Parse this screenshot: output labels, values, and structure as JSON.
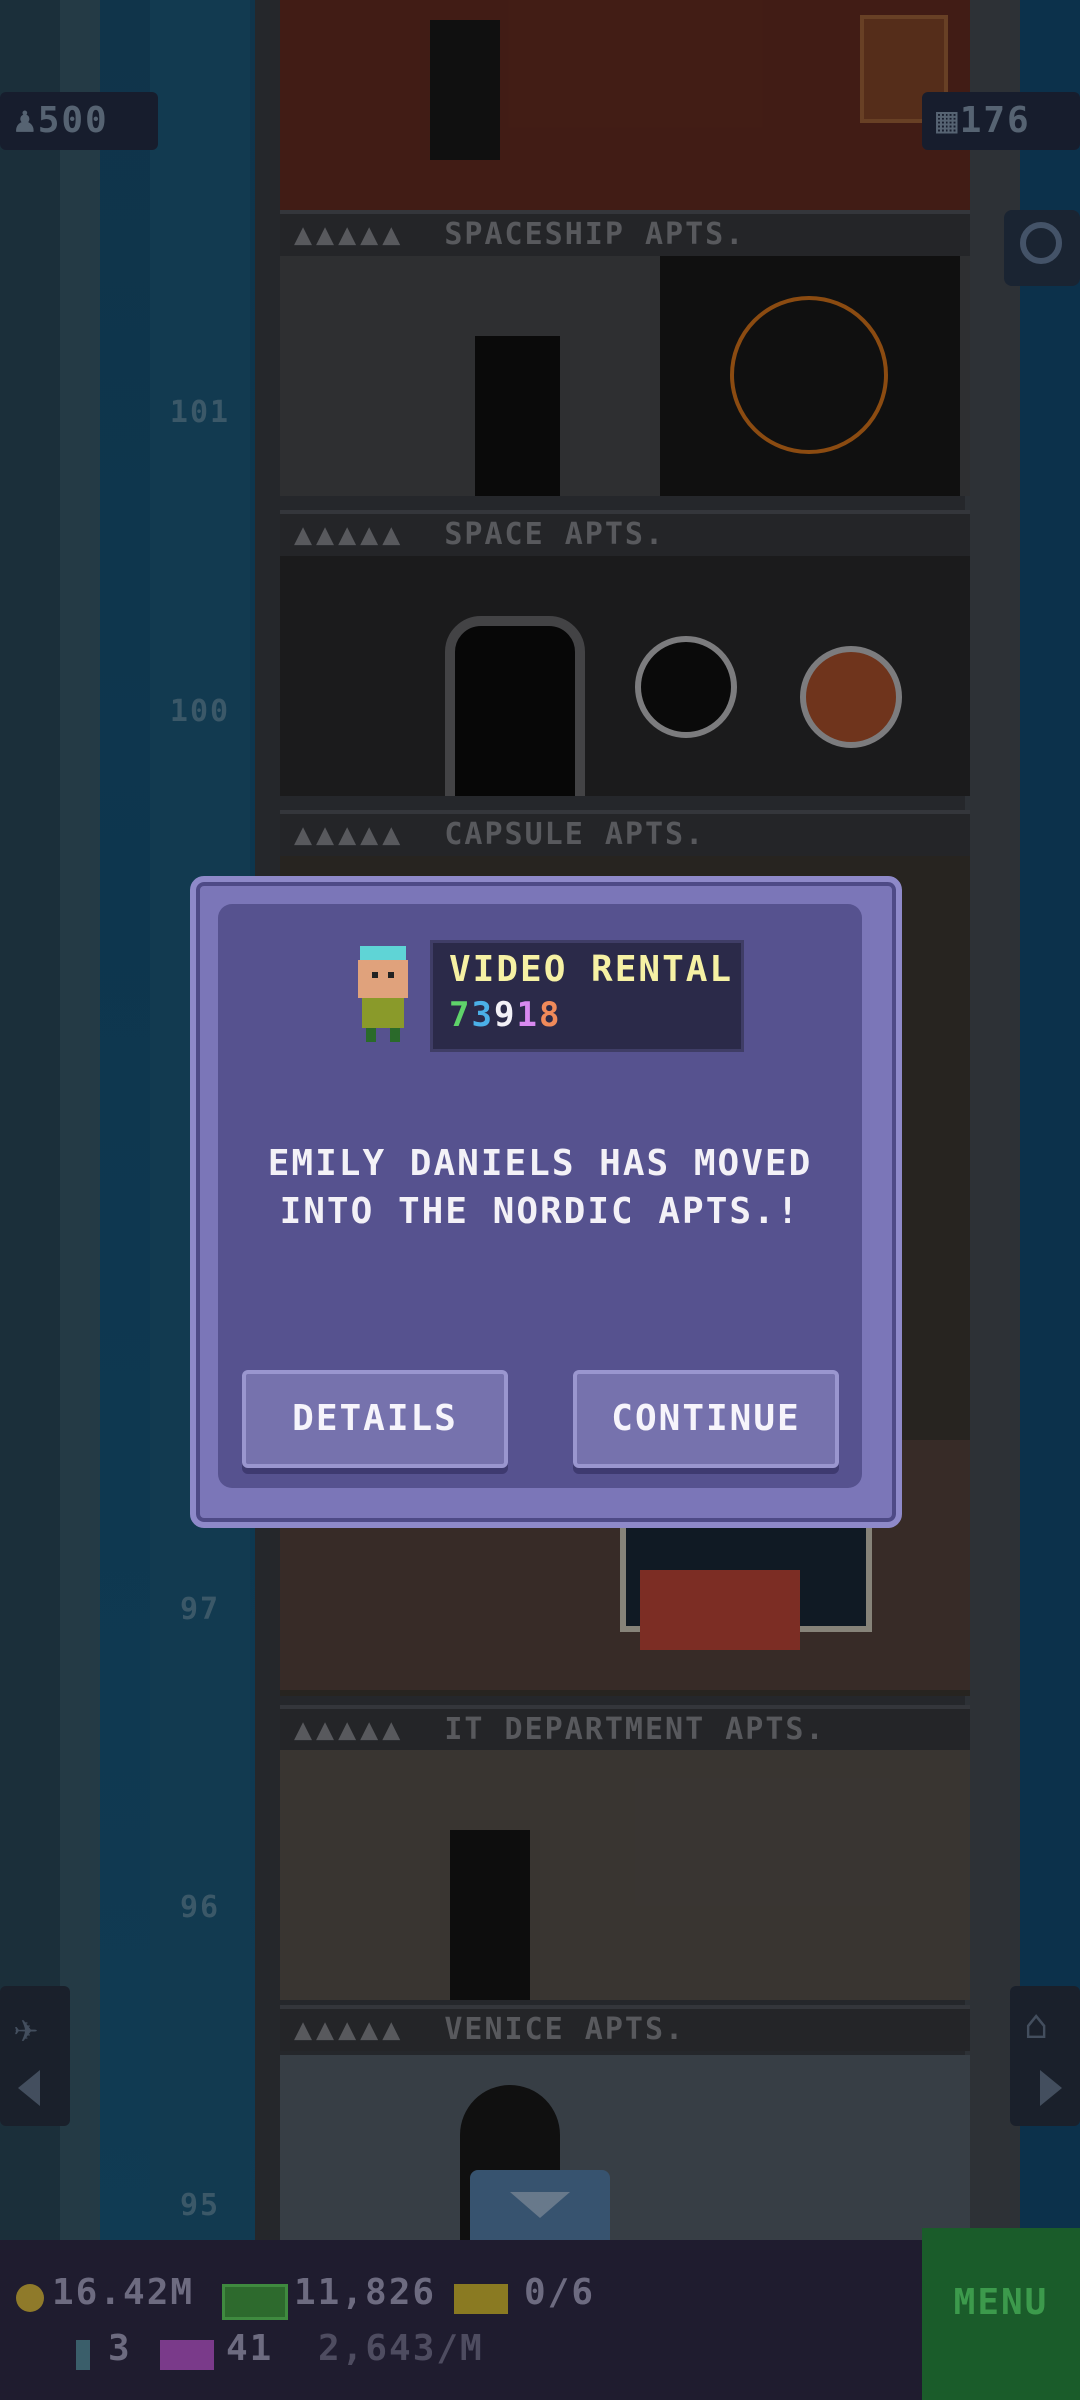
{
  "hud": {
    "population": "500",
    "population_icon": "person-icon",
    "floor_count": "176",
    "floor_icon": "building-icon",
    "search_icon": "magnifier-icon"
  },
  "shaft_floor_numbers": [
    "101",
    "100",
    "97",
    "96",
    "95"
  ],
  "floors": [
    {
      "label": "SPACESHIP APTS.",
      "stars": "▲▲▲▲▲"
    },
    {
      "label": "SPACE APTS.",
      "stars": "▲▲▲▲▲"
    },
    {
      "label": "CAPSULE APTS.",
      "stars": "▲▲▲▲▲"
    },
    {
      "label": "IT DEPARTMENT APTS.",
      "stars": "▲▲▲▲▲"
    },
    {
      "label": "VENICE APTS.",
      "stars": "▲▲▲▲▲"
    }
  ],
  "dialog": {
    "business_name": "VIDEO RENTAL",
    "code_digits": [
      "7",
      "3",
      "9",
      "1",
      "8"
    ],
    "code_colors": [
      "#5fd36a",
      "#4bb0e8",
      "#f3f1f7",
      "#d889f0",
      "#f08a5a"
    ],
    "message_line1": "EMILY DANIELS HAS MOVED",
    "message_line2": "INTO THE NORDIC APTS.!",
    "details_label": "DETAILS",
    "continue_label": "CONTINUE"
  },
  "bottom": {
    "coins": "16.42M",
    "bux": "11,826",
    "tickets": "0/6",
    "elevators": "3",
    "vip": "41",
    "rate": "2,643/M",
    "menu_label": "MENU"
  }
}
